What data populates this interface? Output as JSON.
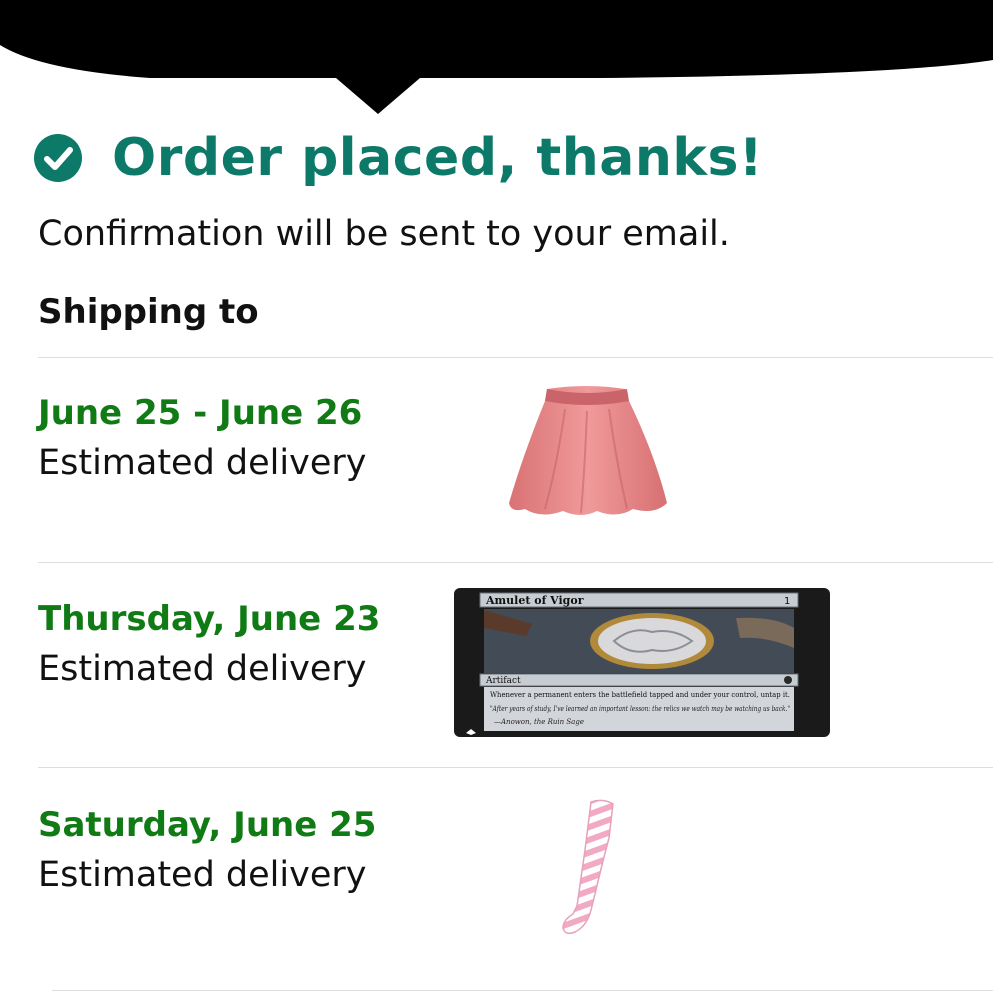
{
  "header": {
    "title": "Order placed, thanks!",
    "confirmation": "Confirmation will be sent to your email.",
    "shipping_label": "Shipping to"
  },
  "deliveries": [
    {
      "date": "June 25 - June 26",
      "label": "Estimated delivery",
      "item_icon": "pink-skirt"
    },
    {
      "date": "Thursday, June 23",
      "label": "Estimated delivery",
      "item_icon": "trading-card"
    },
    {
      "date": "Saturday, June 25",
      "label": "Estimated delivery",
      "item_icon": "striped-stocking"
    }
  ],
  "card": {
    "name": "Amulet of Vigor",
    "type_line": "Artifact",
    "rules_text": "Whenever a permanent enters the battlefield tapped and under your control, untap it.",
    "flavor_text": "\"After years of study, I've learned an important lesson: the relics we watch may be watching us back.\"",
    "flavor_attribution": "—Anowon, the Ruin Sage"
  },
  "colors": {
    "title_green": "#0d7a69",
    "date_green": "#107a14",
    "skirt_pink": "#e88a8c",
    "card_frame": "#1a1a1a"
  }
}
